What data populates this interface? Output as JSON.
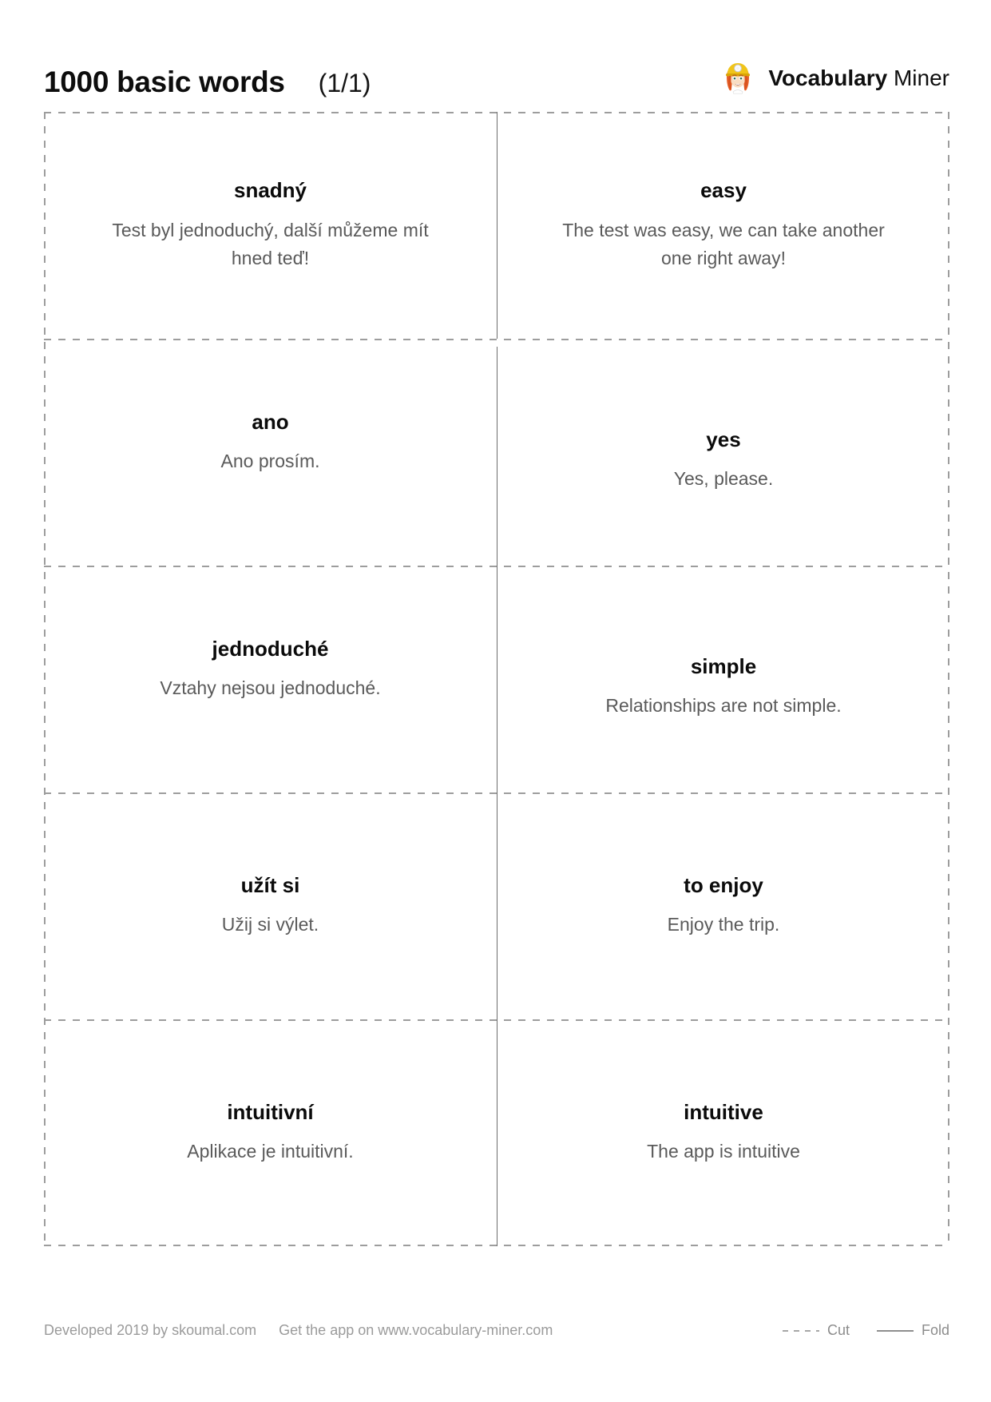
{
  "header": {
    "title": "1000 basic words",
    "page_counter": "(1/1)",
    "brand": {
      "logo_icon": "miner-avatar-icon",
      "name_bold": "Vocabulary",
      "name_light": "Miner"
    }
  },
  "cards": [
    {
      "source": {
        "term": "snadný",
        "example": "Test byl jednoduchý, další můžeme mít hned teď!"
      },
      "target": {
        "term": "easy",
        "example": "The test was easy, we can take another one right away!"
      }
    },
    {
      "source": {
        "term": "ano",
        "example": "Ano prosím."
      },
      "target": {
        "term": "yes",
        "example": "Yes, please."
      }
    },
    {
      "source": {
        "term": "jednoduché",
        "example": "Vztahy nejsou jednoduché."
      },
      "target": {
        "term": "simple",
        "example": "Relationships are not simple."
      }
    },
    {
      "source": {
        "term": "užít si",
        "example": "Užij si výlet."
      },
      "target": {
        "term": "to enjoy",
        "example": "Enjoy the trip."
      }
    },
    {
      "source": {
        "term": "intuitivní",
        "example": "Aplikace je intuitivní."
      },
      "target": {
        "term": "intuitive",
        "example": "The app is intuitive"
      }
    }
  ],
  "footer": {
    "developed_by": "Developed 2019 by skoumal.com",
    "get_the_app": "Get the app on www.vocabulary-miner.com",
    "legend": {
      "cut_label": "Cut",
      "fold_label": "Fold"
    }
  },
  "colors": {
    "term_text": "#0b0b0b",
    "example_text": "#5a5a5a",
    "cut_line": "#9d9d9d",
    "fold_line": "#6f6f6f",
    "footer_text": "#9b9b9b",
    "helmet_yellow": "#f0c419",
    "hair_red": "#e8622a",
    "skin": "#f7d9bf"
  }
}
